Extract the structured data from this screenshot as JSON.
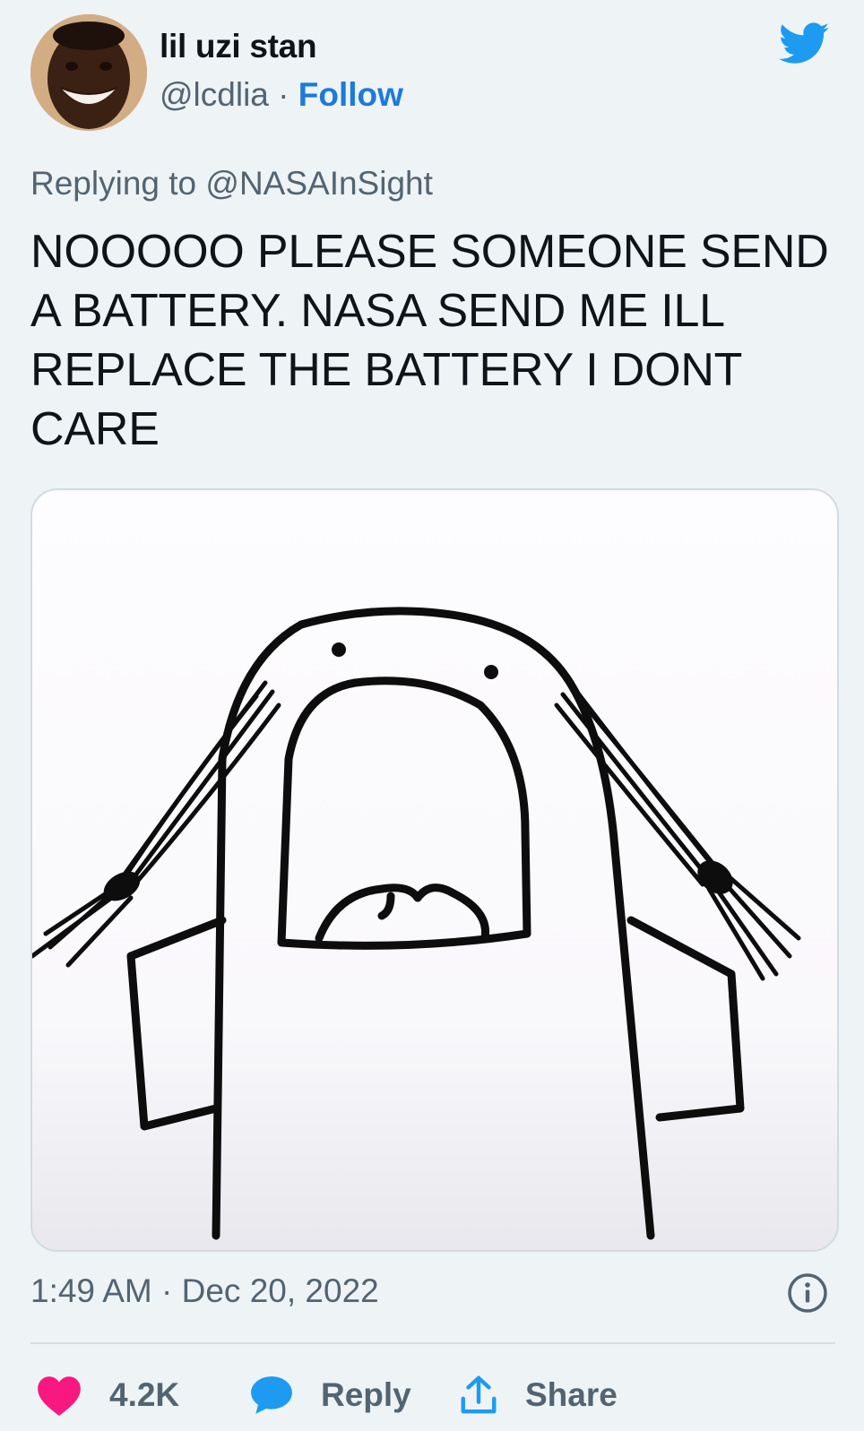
{
  "author": {
    "display_name": "lil uzi stan",
    "handle": "@lcdlia",
    "separator": " · ",
    "follow_label": "Follow"
  },
  "tweet": {
    "reply_to": "Replying to @NASAInSight",
    "text": "NOOOOO PLEASE SOMEONE SEND A BATTERY. NASA SEND ME ILL REPLACE THE BATTERY I DONT CARE",
    "timestamp": "1:49 AM · Dec 20, 2022"
  },
  "actions": {
    "like_count": "4.2K",
    "reply_label": "Reply",
    "share_label": "Share"
  },
  "icons": {
    "logo": "twitter-bird-icon",
    "info": "info-icon",
    "like": "heart-icon",
    "reply": "speech-bubble-icon",
    "share": "share-icon"
  },
  "colors": {
    "accent": "#1d9bf0",
    "follow": "#1d7ad9",
    "like": "#f91880",
    "muted": "#536471",
    "background": "#eef3f6"
  }
}
